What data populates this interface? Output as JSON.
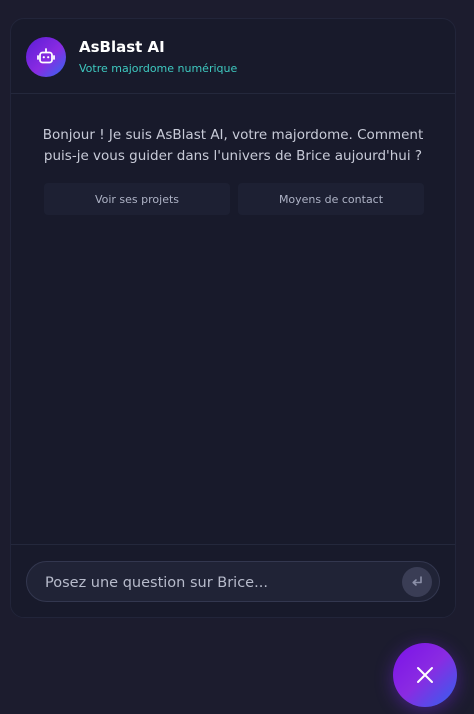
{
  "header": {
    "title": "AsBlast AI",
    "subtitle": "Votre majordome numérique",
    "avatar_icon": "robot-icon"
  },
  "messages": {
    "greeting": "Bonjour ! Je suis AsBlast AI, votre majordome. Comment puis-je vous guider dans l'univers de Brice aujourd'hui ?"
  },
  "suggestions": [
    {
      "label": "Voir ses projets"
    },
    {
      "label": "Moyens de contact"
    }
  ],
  "composer": {
    "placeholder": "Posez une question sur Brice...",
    "value": "",
    "send_icon": "enter-arrow-icon"
  },
  "fab": {
    "icon": "close-icon"
  },
  "colors": {
    "background": "#1c1c2e",
    "panel": "#181a2b",
    "accent_teal": "#3ec9c0",
    "accent_purple": "#8a2be2",
    "accent_blue": "#2f63ef"
  }
}
